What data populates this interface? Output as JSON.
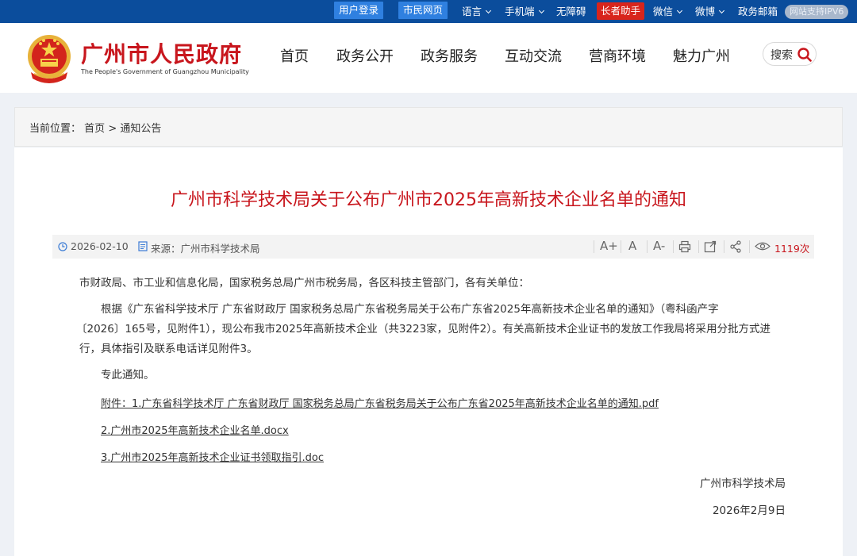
{
  "topbar": {
    "login": "用户登录",
    "citizen": "市民网页",
    "language": "语言",
    "mobile": "手机端",
    "accessibility": "无障碍",
    "elder": "长者助手",
    "wechat": "微信",
    "weibo": "微博",
    "mail": "政务邮箱",
    "ipv6": "网站支持IPV6"
  },
  "header": {
    "title": "广州市人民政府",
    "subtitle": "The People's Government of Guangzhou Municipality",
    "nav": [
      "首页",
      "政务公开",
      "政务服务",
      "互动交流",
      "营商环境",
      "魅力广州"
    ],
    "search_label": "搜索"
  },
  "breadcrumb": {
    "prefix": "当前位置：",
    "home": "首页",
    "sep": ">",
    "current": "通知公告"
  },
  "article": {
    "title": "广州市科学技术局关于公布广州市2025年高新技术企业名单的通知",
    "date": "2026-02-10",
    "source": "来源：广州市科学技术局",
    "views": "1119次",
    "tools": [
      "A+",
      "A",
      "A-"
    ],
    "greeting": "市财政局、市工业和信息化局，国家税务总局广州市税务局，各区科技主管部门，各有关单位：",
    "para_line1": "根据《广东省科学技术厅 广东省财政厅 国家税务总局广东省税务局关于公布广东省2025年高新技术企业名单的通知》（粤科函产字",
    "para_line2": "〔2026〕165号，见附件1），现公布我市2025年高新技术企业（共3223家，见附件2）。有关高新技术企业证书的发放工作我局将采用分批方式进",
    "para_line3": "行，具体指引及联系电话详见附件3。",
    "closing": "专此通知。",
    "attachments": [
      "附件：1.广东省科学技术厅 广东省财政厅 国家税务总局广东省税务局关于公布广东省2025年高新技术企业名单的通知.pdf",
      "2.广州市2025年高新技术企业名单.docx",
      "3.广州市2025年高新技术企业证书领取指引.doc"
    ],
    "signature": "广州市科学技术局",
    "sign_date": "2026年2月9日"
  },
  "colors": {
    "topbar": "#0b4d9c",
    "accent_red": "#c8161d",
    "button_blue": "#2f80e0"
  }
}
